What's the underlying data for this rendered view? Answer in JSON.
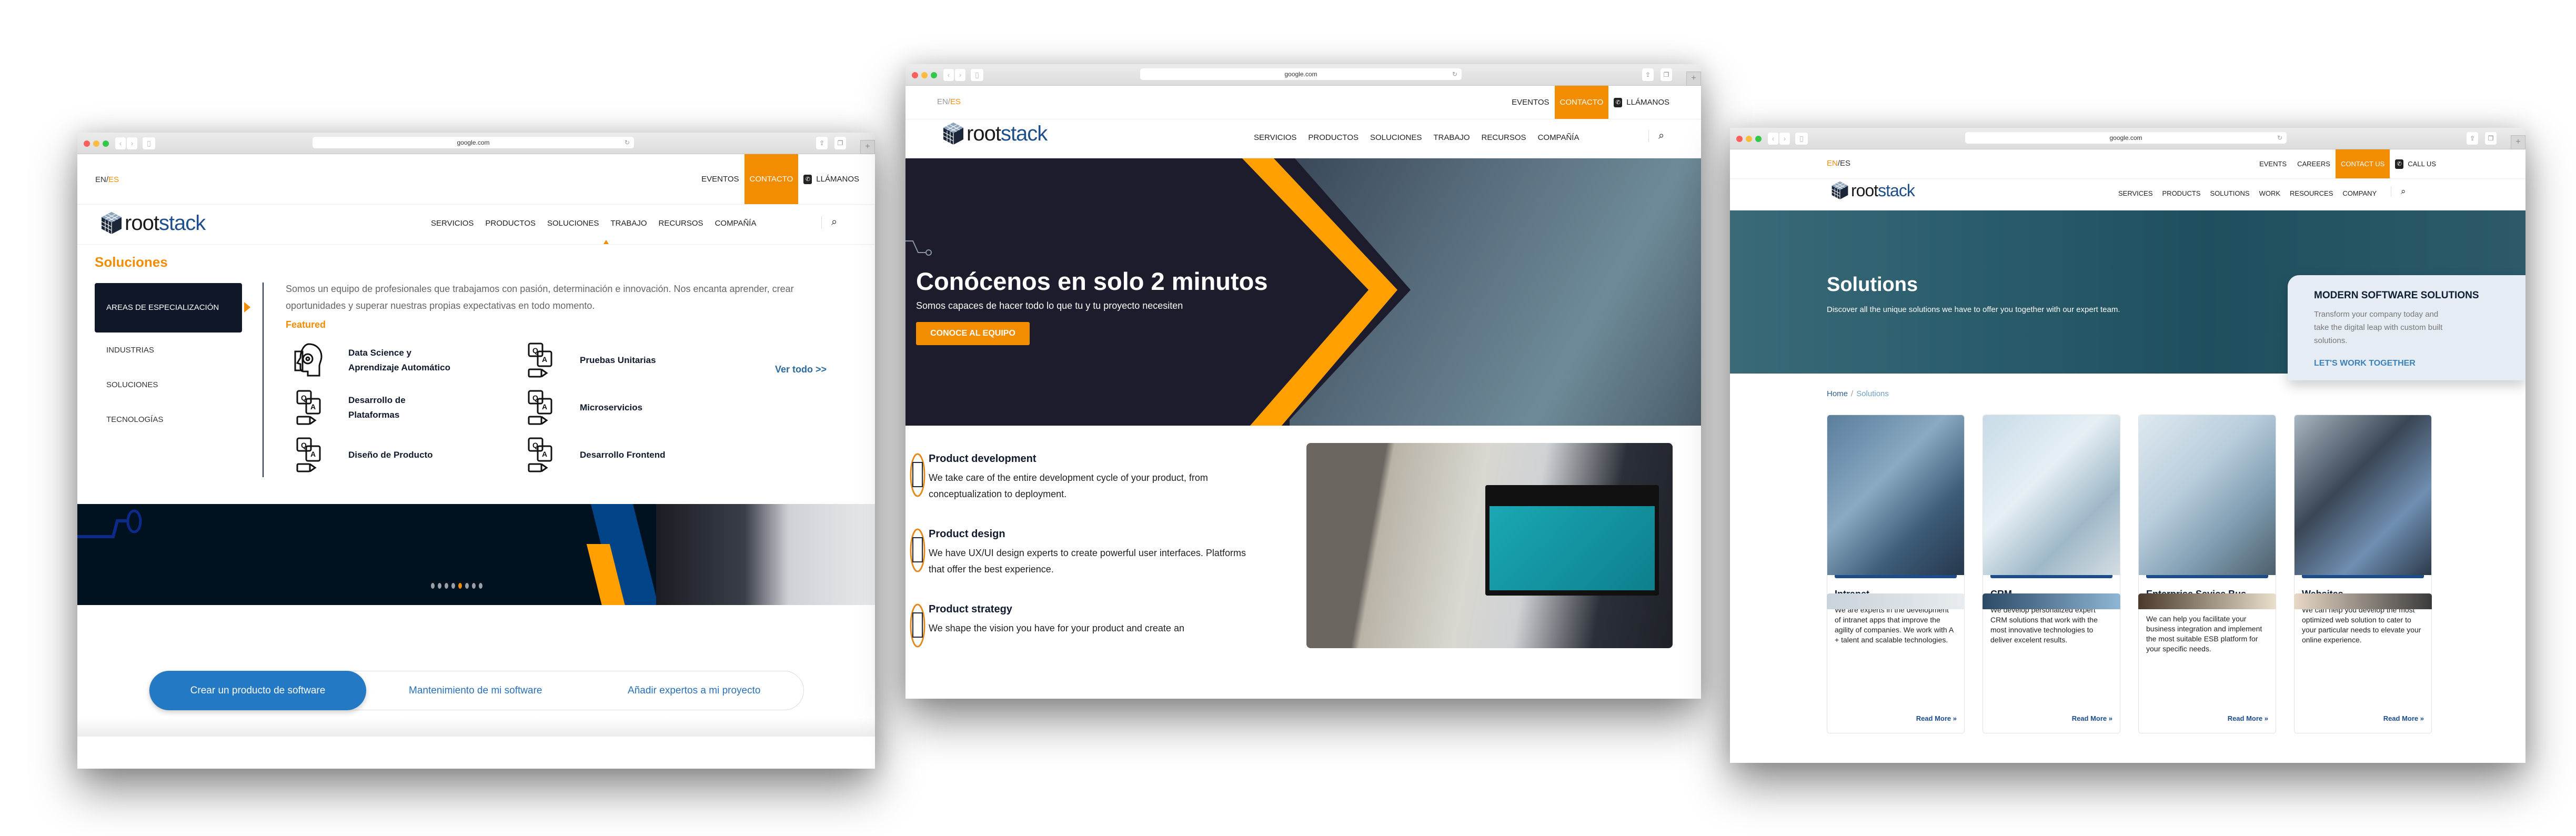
{
  "browser": {
    "url": "google.com"
  },
  "window_left": {
    "lang": {
      "en": "EN",
      "es": "ES",
      "active": "ES"
    },
    "toplinks": {
      "events": "EVENTOS",
      "contact": "CONTACTO",
      "call": "LLÁMANOS"
    },
    "logo": {
      "part1": "root",
      "part2": "stack"
    },
    "menu": [
      "SERVICIOS",
      "PRODUCTOS",
      "SOLUCIONES",
      "TRABAJO",
      "RECURSOS",
      "COMPAÑÍA"
    ],
    "active_menu": "SOLUCIONES",
    "mega": {
      "title": "Soluciones",
      "sidenav": [
        "AREAS DE ESPECIALIZACIÓN",
        "INDUSTRIAS",
        "SOLUCIONES",
        "TECNOLOGÍAS"
      ],
      "description": "Somos un equipo de profesionales que trabajamos con pasión, determinación e innovación. Nos encanta aprender, crear oportunidades y superar nuestras propias expectativas en todo momento.",
      "featured_label": "Featured",
      "featured": [
        {
          "label": "Data Science y Aprendizaje Automático",
          "icon": "ai-gear-head-icon"
        },
        {
          "label": "Pruebas Unitarias",
          "icon": "qa-chat-icon"
        },
        {
          "label": "Desarrollo de Plataformas",
          "icon": "qa-chat-icon"
        },
        {
          "label": "Microservicios",
          "icon": "qa-chat-icon"
        },
        {
          "label": "Diseño de Producto",
          "icon": "qa-chat-icon"
        },
        {
          "label": "Desarrollo Frontend",
          "icon": "qa-chat-icon"
        }
      ],
      "see_all": "Ver todo >>"
    },
    "carousel": {
      "slides": 8,
      "active_index": 4
    },
    "pills": [
      "Crear un producto de software",
      "Mantenimiento de mi software",
      "Añadir expertos a mi proyecto"
    ]
  },
  "window_middle": {
    "lang": {
      "en": "EN",
      "es": "ES",
      "active": "ES"
    },
    "toplinks": {
      "events": "EVENTOS",
      "contact": "CONTACTO",
      "call": "LLÁMANOS"
    },
    "logo": {
      "part1": "root",
      "part2": "stack"
    },
    "menu": [
      "SERVICIOS",
      "PRODUCTOS",
      "SOLUCIONES",
      "TRABAJO",
      "RECURSOS",
      "COMPAÑÍA"
    ],
    "hero": {
      "title": "Conócenos en solo 2 minutos",
      "subtitle": "Somos capaces de hacer todo lo que tu y tu proyecto necesiten",
      "cta": "CONOCE AL EQUIPO"
    },
    "services": [
      {
        "title": "Product development",
        "desc": "We take care of the entire development cycle of your product, from conceptualization to deployment."
      },
      {
        "title": "Product design",
        "desc": "We have UX/UI design experts to create powerful user interfaces. Platforms that offer the best experience."
      },
      {
        "title": "Product strategy",
        "desc": "We shape the vision you have for your product and create an"
      }
    ]
  },
  "window_right": {
    "lang": {
      "en": "EN",
      "es": "ES",
      "active": "EN"
    },
    "toplinks": {
      "events": "EVENTS",
      "careers": "CAREERS",
      "contact": "CONTACT US",
      "call": "CALL US"
    },
    "logo": {
      "part1": "root",
      "part2": "stack"
    },
    "menu": [
      "SERVICES",
      "PRODUCTS",
      "SOLUTIONS",
      "WORK",
      "RESOURCES",
      "COMPANY"
    ],
    "hero": {
      "title": "Solutions",
      "subtitle": "Discover all the unique solutions we have to offer you together with our expert team."
    },
    "promo": {
      "title": "MODERN SOFTWARE SOLUTIONS",
      "desc": "Transform your company today and take the digital leap with custom built solutions.",
      "cta": "LET'S WORK TOGETHER"
    },
    "breadcrumb": {
      "home": "Home",
      "sep": "/",
      "current": "Solutions"
    },
    "cards": [
      {
        "title": "Intranet",
        "desc": "We are experts in the development of intranet apps that improve the agility of companies. We work with A + talent and scalable technologies.",
        "link": "Read More »"
      },
      {
        "title": "CRM",
        "desc": "We develop personalized expert CRM solutions that work with the most innovative technologies to deliver excelent results.",
        "link": "Read More »"
      },
      {
        "title": "Enterprise Sevice Bus (ESB)",
        "desc": "We can help you facilitate your business integration and implement the most suitable ESB platform for your specific needs.",
        "link": "Read More »"
      },
      {
        "title": "Websites",
        "desc": "We can help you develop the most optimized web solution to cater to your particular needs to elevate your online experience.",
        "link": "Read More »"
      }
    ]
  },
  "colors": {
    "accent_orange": "#f28c00",
    "navy": "#0f1729",
    "brand_blue": "#1e4f8c",
    "link_blue": "#2970b8"
  }
}
